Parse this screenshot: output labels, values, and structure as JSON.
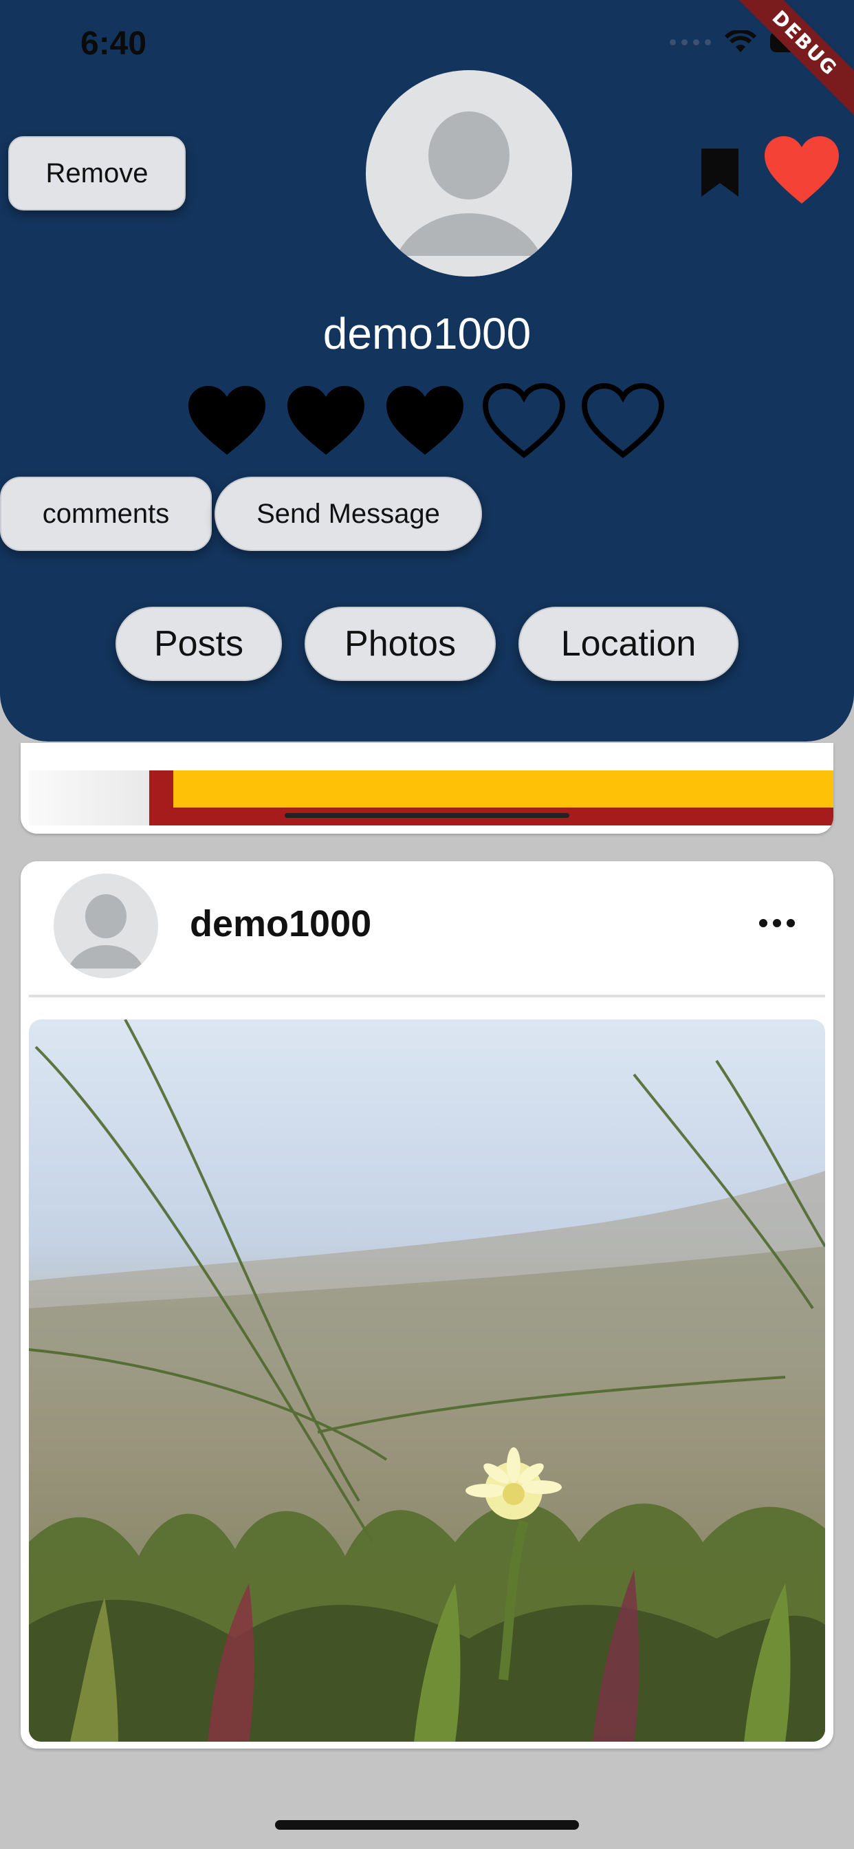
{
  "status_bar": {
    "time": "6:40",
    "debug_label": "DEBUG"
  },
  "profile": {
    "username": "demo1000",
    "rating": {
      "filled": 3,
      "total": 5
    },
    "remove_label": "Remove",
    "comments_label": "comments",
    "message_label": "Send Message",
    "bookmark_icon": "bookmark-icon",
    "favorite_icon": "heart-icon",
    "favorite_color": "#f44336",
    "header_color": "#13345c"
  },
  "tabs": [
    {
      "label": "Posts"
    },
    {
      "label": "Photos"
    },
    {
      "label": "Location"
    }
  ],
  "post": {
    "username": "demo1000",
    "menu_icon": "more-horizontal-icon",
    "image_subject": "photo of yellow ice plant flower on sand dunes"
  }
}
